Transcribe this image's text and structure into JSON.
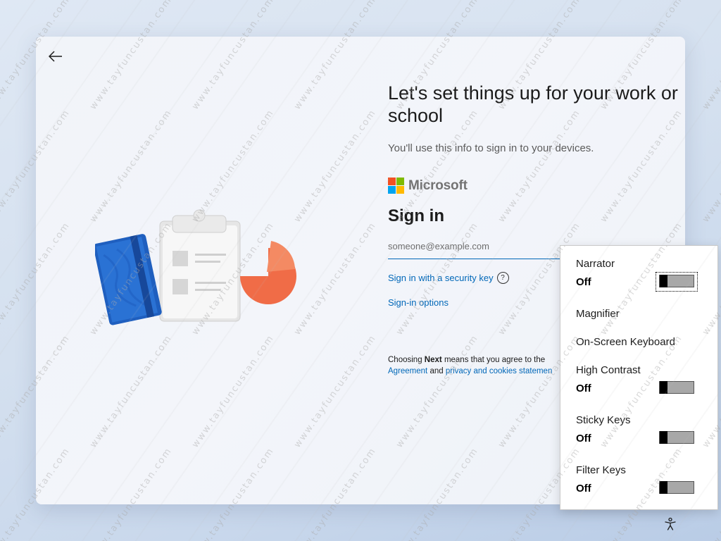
{
  "header": {
    "title": "Let's set things up for your work or school",
    "subtitle": "You'll use this info to sign in to your devices."
  },
  "brand": {
    "name": "Microsoft",
    "colors": [
      "#f25022",
      "#7fba00",
      "#00a4ef",
      "#ffb900"
    ]
  },
  "signin": {
    "heading": "Sign in",
    "email_placeholder": "someone@example.com",
    "email_value": "",
    "security_key_link": "Sign in with a security key",
    "help_icon": "?",
    "options_link": "Sign-in options"
  },
  "agreement": {
    "prefix": "Choosing",
    "next": "Next",
    "middle": "means that you agree to the",
    "link1": "Agreement",
    "and": "and",
    "link2": "privacy and cookies statemen"
  },
  "accessibility": {
    "items": [
      {
        "label": "Narrator",
        "state": "Off",
        "toggle": true
      },
      {
        "label": "Magnifier",
        "toggle": false
      },
      {
        "label": "On-Screen Keyboard",
        "toggle": false
      },
      {
        "label": "High Contrast",
        "state": "Off",
        "toggle": true
      },
      {
        "label": "Sticky Keys",
        "state": "Off",
        "toggle": true
      },
      {
        "label": "Filter Keys",
        "state": "Off",
        "toggle": true
      }
    ]
  },
  "icons": {
    "back": "back-arrow-icon",
    "accessibility": "accessibility-icon"
  },
  "watermark": "www.tayfuncustan.com",
  "colors": {
    "link": "#0067b8",
    "accent_orange": "#f26f4b",
    "notebook_blue": "#1f5fbf"
  }
}
